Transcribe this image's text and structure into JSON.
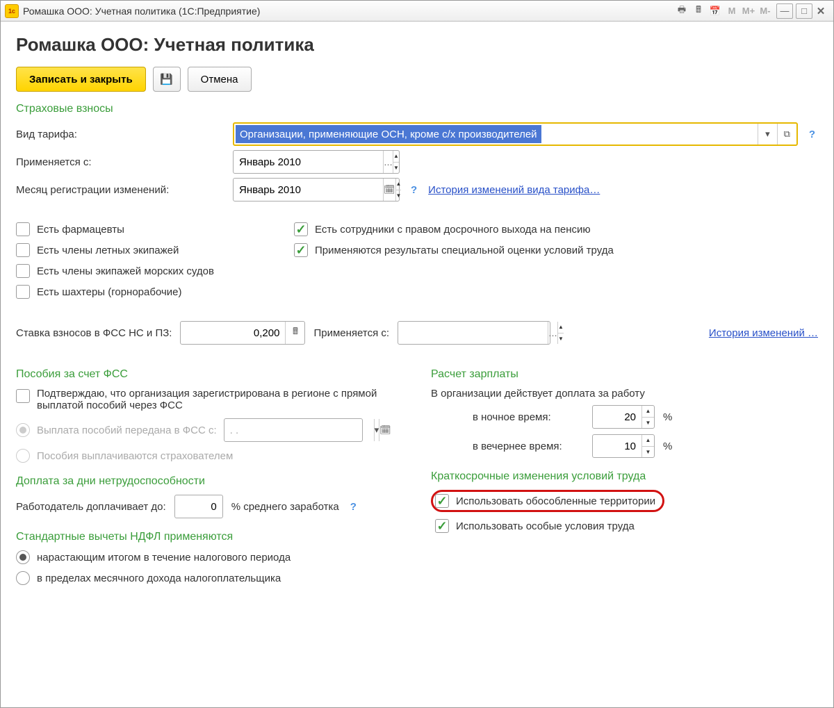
{
  "titlebar": {
    "text": "Ромашка ООО: Учетная политика  (1С:Предприятие)"
  },
  "header": {
    "title": "Ромашка ООО: Учетная политика"
  },
  "toolbar": {
    "write_close": "Записать и закрыть",
    "cancel": "Отмена"
  },
  "insurance": {
    "section": "Страховые взносы",
    "tariff_label": "Вид тарифа:",
    "tariff_value": "Организации, применяющие ОСН, кроме с/х производителей",
    "applies_from_label": "Применяется с:",
    "applies_from_value": "Январь 2010",
    "reg_month_label": "Месяц регистрации изменений:",
    "reg_month_value": "Январь 2010",
    "history_link": "История изменений вида тарифа…"
  },
  "checks_left": {
    "pharmacists": "Есть фармацевты",
    "flight_crew": "Есть члены летных экипажей",
    "sea_crew": "Есть члены экипажей морских судов",
    "miners": "Есть шахтеры (горнорабочие)"
  },
  "checks_right": {
    "early_pension": "Есть сотрудники с правом досрочного выхода на пенсию",
    "sout_results": "Применяются результаты специальной оценки условий труда"
  },
  "fss_rate": {
    "label": "Ставка взносов в ФСС НС и ПЗ:",
    "value": "0,200",
    "applies_label": "Применяется с:",
    "applies_value": "",
    "history_link": "История изменений …"
  },
  "benefits": {
    "section": "Пособия за счет ФСС",
    "confirm": "Подтверждаю, что организация зарегистрирована в регионе с прямой выплатой пособий через ФСС",
    "rb1": "Выплата пособий передана в ФСС с:",
    "rb1_date": ". .",
    "rb2": "Пособия выплачиваются страхователем"
  },
  "salary": {
    "section": "Расчет зарплаты",
    "intro": "В организации действует доплата за работу",
    "night_label": "в ночное время:",
    "night_value": "20",
    "evening_label": "в вечернее время:",
    "evening_value": "10",
    "pct": "%"
  },
  "short_term": {
    "section": "Краткосрочные изменения условий труда",
    "territories": "Использовать обособленные территории",
    "conditions": "Использовать особые условия труда"
  },
  "sick": {
    "section": "Доплата за дни нетрудоспособности",
    "label": "Работодатель доплачивает до:",
    "value": "0",
    "suffix": "% среднего заработка"
  },
  "ndfl": {
    "section": "Стандартные вычеты НДФЛ применяются",
    "rb1": "нарастающим итогом в течение налогового периода",
    "rb2": "в пределах месячного дохода налогоплательщика"
  }
}
